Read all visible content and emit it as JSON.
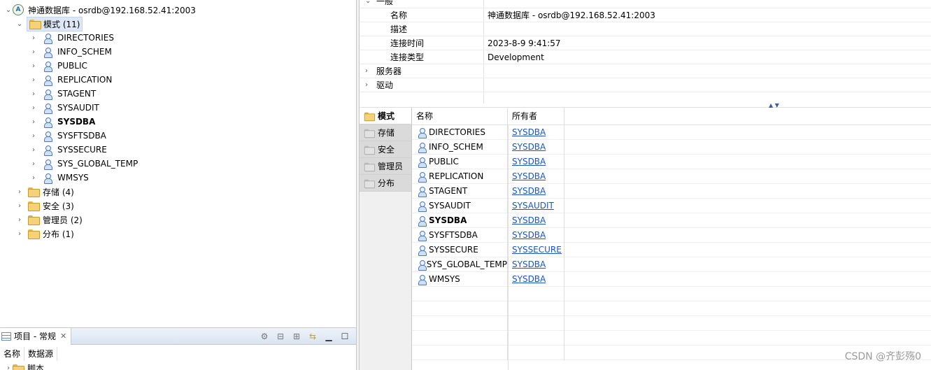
{
  "tree": {
    "connection_label": "神通数据库 - osrdb@192.168.52.41:2003",
    "schema_folder_label": "模式 (11)",
    "schemas": [
      {
        "label": "DIRECTORIES",
        "bold": false
      },
      {
        "label": "INFO_SCHEM",
        "bold": false
      },
      {
        "label": "PUBLIC",
        "bold": false
      },
      {
        "label": "REPLICATION",
        "bold": false
      },
      {
        "label": "STAGENT",
        "bold": false
      },
      {
        "label": "SYSAUDIT",
        "bold": false
      },
      {
        "label": "SYSDBA",
        "bold": true
      },
      {
        "label": "SYSFTSDBA",
        "bold": false
      },
      {
        "label": "SYSSECURE",
        "bold": false
      },
      {
        "label": "SYS_GLOBAL_TEMP",
        "bold": false
      },
      {
        "label": "WMSYS",
        "bold": false
      }
    ],
    "folders": [
      {
        "label": "存储 (4)",
        "icon": "folder-icon"
      },
      {
        "label": "安全 (3)",
        "icon": "folder-icon"
      },
      {
        "label": "管理员 (2)",
        "icon": "admin-folder-icon"
      },
      {
        "label": "分布 (1)",
        "icon": "folder-icon"
      }
    ]
  },
  "project_panel": {
    "tab_label": "项目 - 常规",
    "columns": [
      "名称",
      "数据源"
    ],
    "first_row_label": "脚本"
  },
  "properties": {
    "general_label": "一般",
    "rows": [
      {
        "key": "名称",
        "value": "神通数据库 - osrdb@192.168.52.41:2003"
      },
      {
        "key": "描述",
        "value": ""
      },
      {
        "key": "连接时间",
        "value": "2023-8-9 9:41:57"
      },
      {
        "key": "连接类型",
        "value": "Development"
      }
    ],
    "categories": [
      "服务器",
      "驱动"
    ]
  },
  "side_tabs": [
    {
      "label": "模式",
      "active": true
    },
    {
      "label": "存储",
      "active": false
    },
    {
      "label": "安全",
      "active": false
    },
    {
      "label": "管理员",
      "active": false
    },
    {
      "label": "分布",
      "active": false
    }
  ],
  "schema_table": {
    "columns": [
      "名称",
      "所有者"
    ],
    "rows": [
      {
        "name": "DIRECTORIES",
        "owner": "SYSDBA",
        "bold": false
      },
      {
        "name": "INFO_SCHEM",
        "owner": "SYSDBA",
        "bold": false
      },
      {
        "name": "PUBLIC",
        "owner": "SYSDBA",
        "bold": false
      },
      {
        "name": "REPLICATION",
        "owner": "SYSDBA",
        "bold": false
      },
      {
        "name": "STAGENT",
        "owner": "SYSDBA",
        "bold": false
      },
      {
        "name": "SYSAUDIT",
        "owner": "SYSAUDIT",
        "bold": false
      },
      {
        "name": "SYSDBA",
        "owner": "SYSDBA",
        "bold": true
      },
      {
        "name": "SYSFTSDBA",
        "owner": "SYSDBA",
        "bold": false
      },
      {
        "name": "SYSSECURE",
        "owner": "SYSSECURE",
        "bold": false
      },
      {
        "name": "SYS_GLOBAL_TEMP",
        "owner": "SYSDBA",
        "bold": false
      },
      {
        "name": "WMSYS",
        "owner": "SYSDBA",
        "bold": false
      }
    ]
  },
  "watermark": "CSDN @齐彭殇0"
}
